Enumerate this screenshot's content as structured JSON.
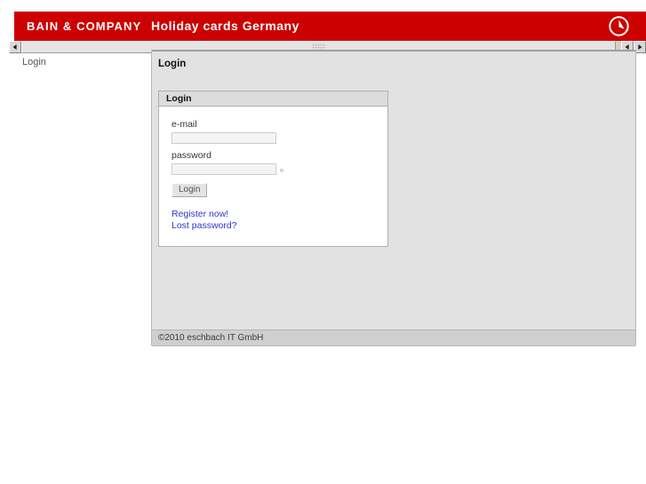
{
  "header": {
    "brand": "BAIN & COMPANY",
    "title": "Holiday cards Germany",
    "emblem_icon": "circle-pie-icon",
    "background_color": "#cc0000",
    "text_color": "#ffffff"
  },
  "scrollbar": {
    "left_button_icon": "arrow-left-icon",
    "right_button_icon": "arrow-right-icon",
    "grip_icon": "scrollbar-grip-icon",
    "orientation": "horizontal"
  },
  "sidebar": {
    "items": [
      {
        "label": "Login"
      }
    ]
  },
  "main": {
    "page_title": "Login",
    "login_box": {
      "header": "Login",
      "email": {
        "label": "e-mail",
        "value": "",
        "placeholder": ""
      },
      "password": {
        "label": "password",
        "value": "",
        "placeholder": ""
      },
      "submit_label": "Login",
      "links": [
        {
          "label": "Register now!"
        },
        {
          "label": "Lost password?"
        }
      ],
      "link_color": "#2b38c4"
    },
    "footer": "©2010 eschbach IT GmbH"
  }
}
